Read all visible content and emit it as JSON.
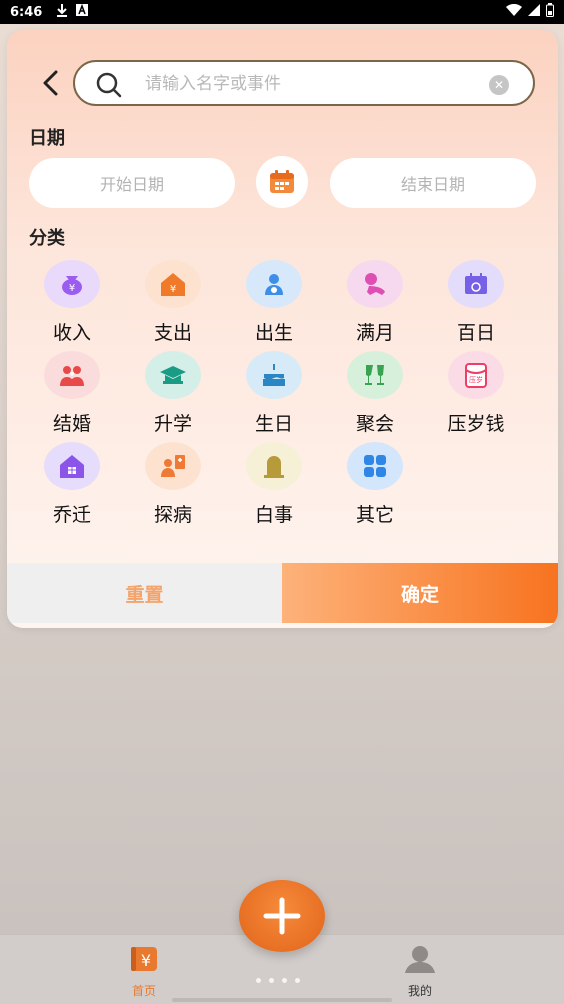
{
  "status_bar": {
    "time": "6:46"
  },
  "search": {
    "placeholder": "请输入名字或事件",
    "value": ""
  },
  "date_section": {
    "title": "日期",
    "start_placeholder": "开始日期",
    "end_placeholder": "结束日期"
  },
  "category_section": {
    "title": "分类",
    "items": [
      {
        "label": "收入",
        "icon": "money-bag-icon",
        "bg": "#e9d9fb",
        "color": "#9b5cf0"
      },
      {
        "label": "支出",
        "icon": "house-yen-icon",
        "bg": "#fde3cf",
        "color": "#f07a2a"
      },
      {
        "label": "出生",
        "icon": "baby-icon",
        "bg": "#d7e8fb",
        "color": "#3d8ee6"
      },
      {
        "label": "满月",
        "icon": "crawling-baby-icon",
        "bg": "#f7d9ef",
        "color": "#de4fb3"
      },
      {
        "label": "百日",
        "icon": "calendar-icon",
        "bg": "#e3dcfb",
        "color": "#7760e8"
      },
      {
        "label": "结婚",
        "icon": "couple-icon",
        "bg": "#fbdcdc",
        "color": "#e84a4a"
      },
      {
        "label": "升学",
        "icon": "graduation-cap-icon",
        "bg": "#d4efe8",
        "color": "#1a9c84"
      },
      {
        "label": "生日",
        "icon": "cake-icon",
        "bg": "#d6ebf7",
        "color": "#2a87c4"
      },
      {
        "label": "聚会",
        "icon": "cheers-icon",
        "bg": "#d7f0dc",
        "color": "#3aa352"
      },
      {
        "label": "压岁钱",
        "icon": "red-envelope-icon",
        "bg": "#fbdce6",
        "color": "#ef3e66"
      },
      {
        "label": "乔迁",
        "icon": "new-home-icon",
        "bg": "#e6dcfb",
        "color": "#8a55e8"
      },
      {
        "label": "探病",
        "icon": "visit-patient-icon",
        "bg": "#fde3cf",
        "color": "#ee7a35"
      },
      {
        "label": "白事",
        "icon": "tombstone-icon",
        "bg": "#f5f0d6",
        "color": "#b79a3a"
      },
      {
        "label": "其它",
        "icon": "grid-icon",
        "bg": "#d3e6fb",
        "color": "#2f86e6"
      }
    ]
  },
  "buttons": {
    "reset": "重置",
    "confirm": "确定"
  },
  "bottom_nav": {
    "home": "首页",
    "mine": "我的"
  }
}
